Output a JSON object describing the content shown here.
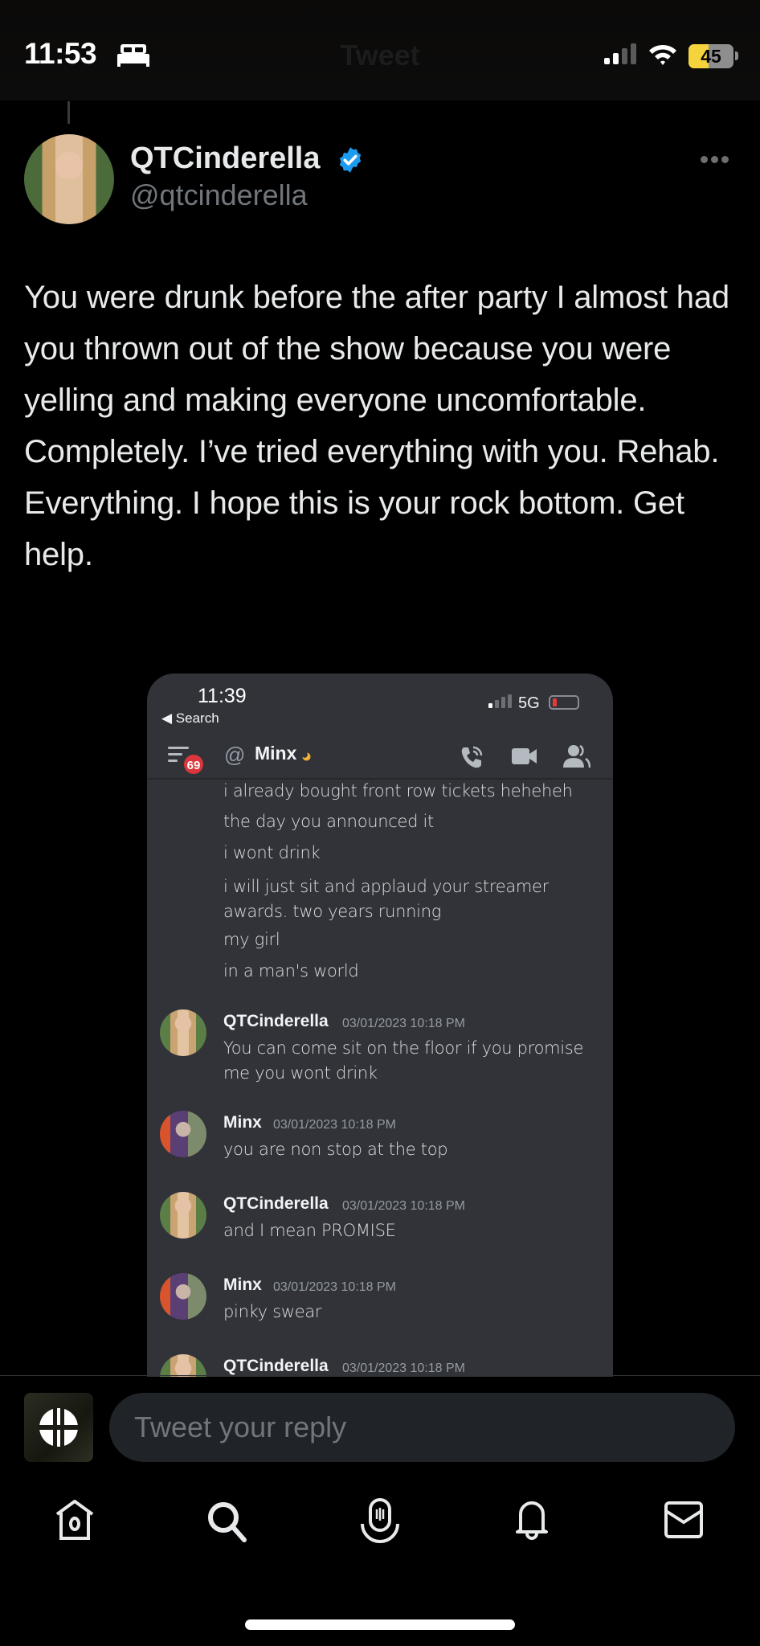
{
  "status_bar": {
    "time": "11:53",
    "focus_icon": "bed-icon",
    "header_title": "Tweet",
    "battery_percent": 45,
    "battery_label": "45"
  },
  "tweet": {
    "author": {
      "display_name": "QTCinderella",
      "handle": "@qtcinderella",
      "verified": true
    },
    "text": "You were drunk before the after party I almost had you thrown out of the show because you were yelling and making everyone uncomfortable. Completely. I’ve tried everything with you. Rehab. Everything. I hope this is your rock bottom. Get help.",
    "embedded_screenshot": {
      "status": {
        "time": "11:39",
        "back_label": "◀ Search",
        "network": "5G"
      },
      "channel_header": {
        "unread_count": "69",
        "at_symbol": "@",
        "name": "Minx",
        "accent_colors": {
          "badge": "#da373c",
          "idle": "#f0b232"
        }
      },
      "continuation_lines": [
        "i already bought front row tickets heheheh",
        "the day you announced it",
        "i wont drink",
        "i will just sit and applaud your streamer awards. two years running",
        "my girl",
        "in a man's world"
      ],
      "messages": [
        {
          "author": "QTCinderella",
          "timestamp": "03/01/2023 10:18 PM",
          "text": "You can come sit on the floor if you promise me you wont drink"
        },
        {
          "author": "Minx",
          "timestamp": "03/01/2023 10:18 PM",
          "text": "you are non stop at the top"
        },
        {
          "author": "QTCinderella",
          "timestamp": "03/01/2023 10:18 PM",
          "text": "and I mean PROMISE"
        },
        {
          "author": "Minx",
          "timestamp": "03/01/2023 10:18 PM",
          "text": "pinky swear"
        },
        {
          "author": "QTCinderella",
          "timestamp": "03/01/2023 10:18 PM",
          "text": ""
        }
      ]
    }
  },
  "reply": {
    "placeholder": "Tweet your reply",
    "value": ""
  },
  "tabbar": {
    "items": [
      {
        "name": "home",
        "icon": "home-icon"
      },
      {
        "name": "search",
        "icon": "search-icon"
      },
      {
        "name": "spaces",
        "icon": "spaces-icon"
      },
      {
        "name": "notifications",
        "icon": "bell-icon"
      },
      {
        "name": "messages",
        "icon": "mail-icon"
      }
    ]
  },
  "colors": {
    "background": "#000000",
    "text_primary": "#e7e9ea",
    "text_secondary": "#71767b",
    "verified": "#1d9bf0",
    "discord_bg": "#313338",
    "battery_fill": "#f5d33c"
  }
}
